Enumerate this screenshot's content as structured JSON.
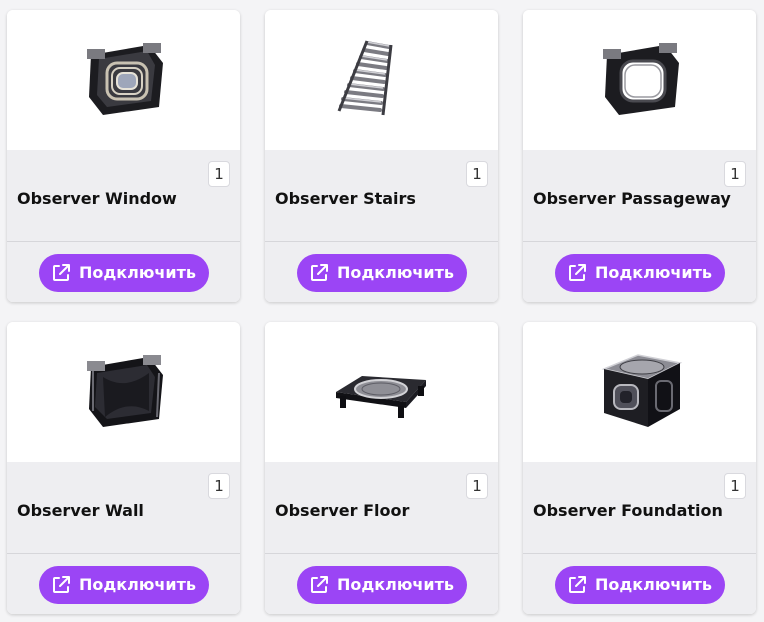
{
  "items": [
    {
      "title": "Observer Window",
      "count": "1",
      "button": "Подключить",
      "image_icon": "observer-window-icon"
    },
    {
      "title": "Observer Stairs",
      "count": "1",
      "button": "Подключить",
      "image_icon": "observer-stairs-icon"
    },
    {
      "title": "Observer Passageway",
      "count": "1",
      "button": "Подключить",
      "image_icon": "observer-passageway-icon"
    },
    {
      "title": "Observer Wall",
      "count": "1",
      "button": "Подключить",
      "image_icon": "observer-wall-icon"
    },
    {
      "title": "Observer Floor",
      "count": "1",
      "button": "Подключить",
      "image_icon": "observer-floor-icon"
    },
    {
      "title": "Observer Foundation",
      "count": "1",
      "button": "Подключить",
      "image_icon": "observer-foundation-icon"
    }
  ],
  "colors": {
    "accent": "#9b45f5",
    "card_info_bg": "#eeeef1",
    "page_bg": "#f4f4f6"
  }
}
